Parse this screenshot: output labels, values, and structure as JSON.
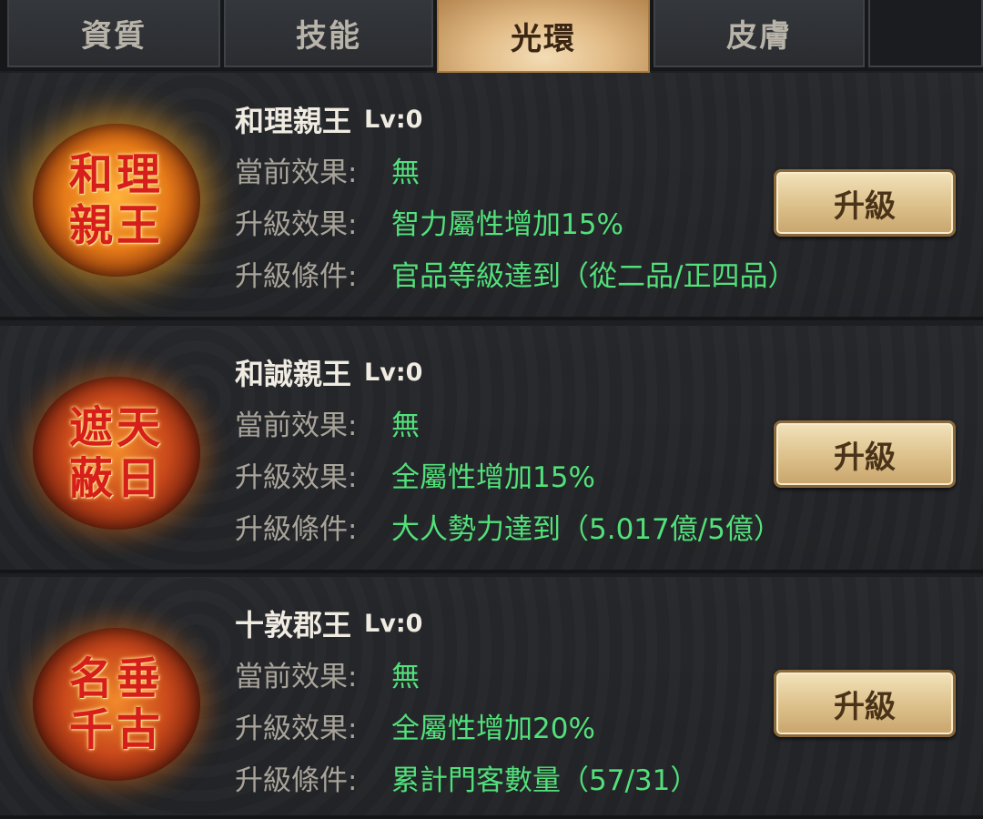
{
  "tabs": [
    {
      "label": "資質"
    },
    {
      "label": "技能"
    },
    {
      "label": "光環"
    },
    {
      "label": "皮膚"
    },
    {
      "label": ""
    }
  ],
  "active_tab": "光環",
  "labels": {
    "current_effect": "當前效果:",
    "upgrade_effect": "升級效果:",
    "upgrade_condition": "升級條件:",
    "upgrade_button": "升級"
  },
  "halos": [
    {
      "name": "和理親王",
      "level": "Lv:0",
      "seal_line1": "和理",
      "seal_line2": "親王",
      "current_effect": "無",
      "upgrade_effect": "智力屬性增加15%",
      "upgrade_condition": "官品等級達到（從二品/正四品）"
    },
    {
      "name": "和誠親王",
      "level": "Lv:0",
      "seal_line1": "遮天",
      "seal_line2": "蔽日",
      "current_effect": "無",
      "upgrade_effect": "全屬性增加15%",
      "upgrade_condition": "大人勢力達到（5.017億/5億）"
    },
    {
      "name": "十敦郡王",
      "level": "Lv:0",
      "seal_line1": "名垂",
      "seal_line2": "千古",
      "current_effect": "無",
      "upgrade_effect": "全屬性增加20%",
      "upgrade_condition": "累計門客數量（57/31）"
    }
  ],
  "colors": {
    "value_green": "#52e07a",
    "label_gray": "#a9a49a",
    "active_tab_gold": "#e2bc87"
  }
}
